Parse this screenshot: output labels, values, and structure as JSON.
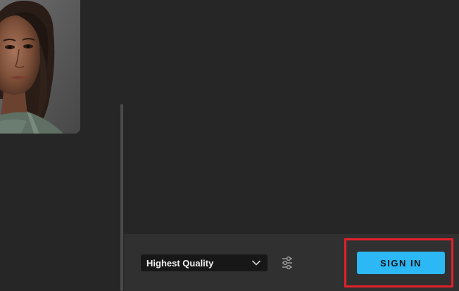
{
  "gallery": {
    "thumbnail_icon": "character-portrait"
  },
  "footer": {
    "quality_select": {
      "selected": "Highest Quality",
      "icon": "chevron-down-icon"
    },
    "settings_icon": "sliders-icon",
    "signin_label": "SIGN IN"
  },
  "colors": {
    "background": "#262626",
    "footer_bar": "#303030",
    "select_bg": "#171717",
    "accent": "#2bb8f4",
    "highlight": "#e3202b"
  }
}
